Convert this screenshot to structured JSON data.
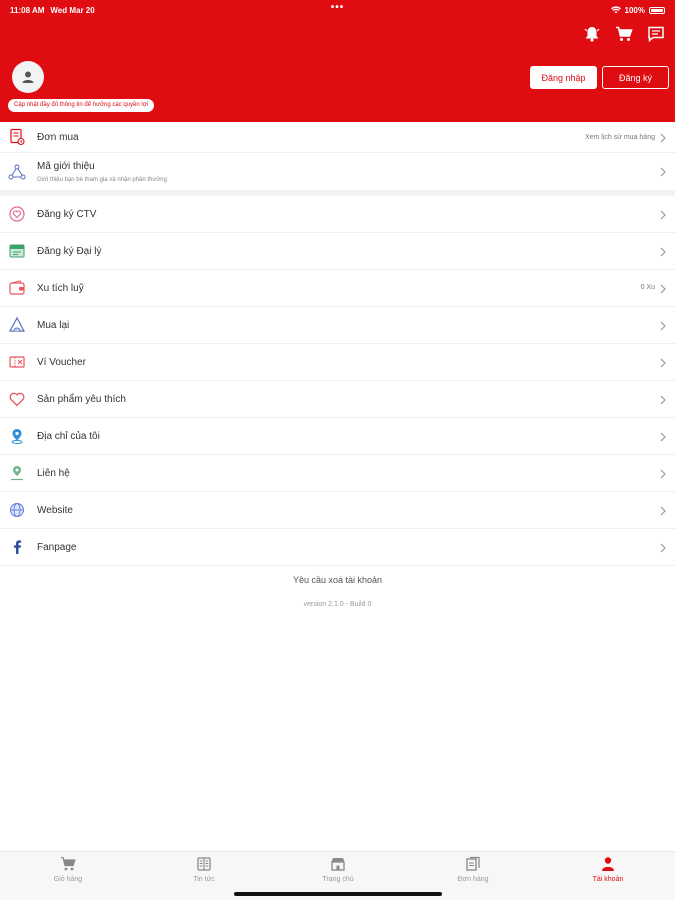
{
  "status_bar": {
    "time": "11:08 AM",
    "date": "Wed Mar 20",
    "battery": "100%"
  },
  "header": {
    "notice": "Cập nhật đầy đủ thông tin để hưởng các quyền lợi",
    "login_label": "Đăng nhập",
    "register_label": "Đăng ký",
    "bg_color": "#df0c12"
  },
  "orders": {
    "label": "Đơn mua",
    "right": "Xem lịch sử mua hàng"
  },
  "referral": {
    "label": "Mã giới thiệu",
    "sub": "Giới thiệu bạn bè tham gia và nhận phần thưởng"
  },
  "menu": [
    {
      "label": "Đăng ký CTV",
      "icon": "heart-circle-icon"
    },
    {
      "label": "Đăng ký Đại lý",
      "icon": "store-icon"
    },
    {
      "label": "Xu tích luỹ",
      "icon": "wallet-icon",
      "right": "0 Xu"
    },
    {
      "label": "Mua lại",
      "icon": "repurchase-icon"
    },
    {
      "label": "Ví Voucher",
      "icon": "voucher-icon"
    },
    {
      "label": "Sản phẩm yêu thích",
      "icon": "heart-icon"
    },
    {
      "label": "Địa chỉ của tôi",
      "icon": "location-icon"
    },
    {
      "label": "Liên hệ",
      "icon": "contact-icon"
    },
    {
      "label": "Website",
      "icon": "globe-icon"
    },
    {
      "label": "Fanpage",
      "icon": "facebook-icon"
    }
  ],
  "footer": {
    "delete_account": "Yêu cầu xoá tài khoản",
    "version": "version 2.1.0 - Build 0"
  },
  "tabs": [
    {
      "label": "Giỏ hàng",
      "icon": "cart-icon"
    },
    {
      "label": "Tin tức",
      "icon": "news-icon"
    },
    {
      "label": "Trang chủ",
      "icon": "home-store-icon"
    },
    {
      "label": "Đơn hàng",
      "icon": "orders-icon"
    },
    {
      "label": "Tài khoản",
      "icon": "user-icon",
      "active": true
    }
  ]
}
